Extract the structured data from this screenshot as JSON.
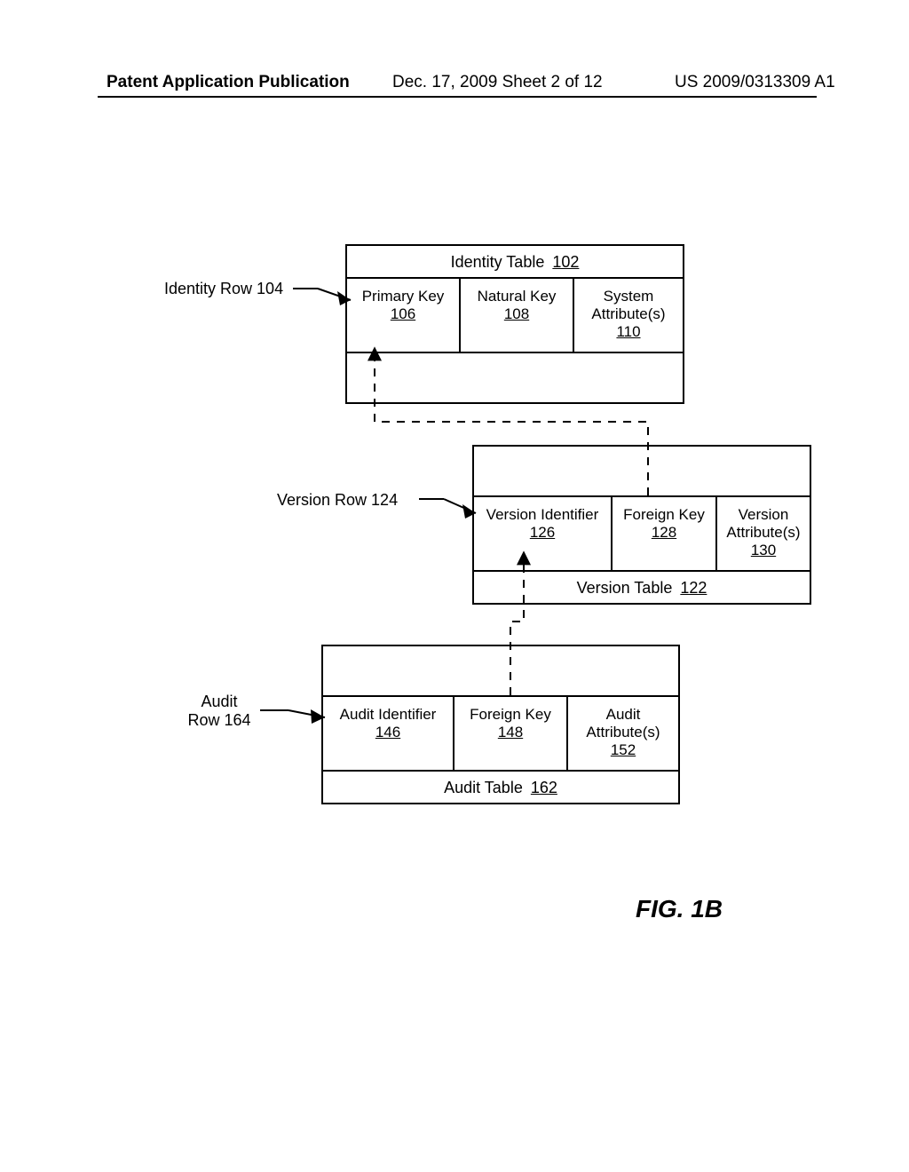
{
  "header": {
    "left": "Patent Application Publication",
    "mid": "Dec. 17, 2009  Sheet 2 of 12",
    "right": "US 2009/0313309 A1"
  },
  "identity": {
    "title_text": "Identity Table",
    "title_ref": "102",
    "row_label": "Identity Row 104",
    "cells": [
      {
        "label": "Primary Key",
        "ref": "106"
      },
      {
        "label": "Natural Key",
        "ref": "108"
      },
      {
        "label": "System Attribute(s)",
        "ref": "110"
      }
    ]
  },
  "version": {
    "title_text": "Version Table",
    "title_ref": "122",
    "row_label": "Version Row 124",
    "cells": [
      {
        "label": "Version Identifier",
        "ref": "126"
      },
      {
        "label": "Foreign Key",
        "ref": "128"
      },
      {
        "label": "Version Attribute(s)",
        "ref": "130"
      }
    ]
  },
  "audit": {
    "title_text": "Audit Table",
    "title_ref": "162",
    "row_label_1": "Audit",
    "row_label_2": "Row 164",
    "cells": [
      {
        "label": "Audit Identifier",
        "ref": "146"
      },
      {
        "label": "Foreign Key",
        "ref": "148"
      },
      {
        "label": "Audit Attribute(s)",
        "ref": "152"
      }
    ]
  },
  "figure_caption": "FIG. 1B"
}
